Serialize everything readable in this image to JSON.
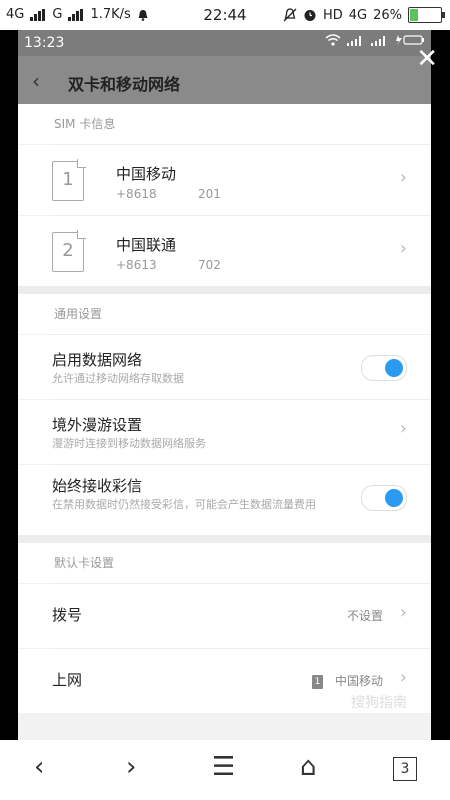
{
  "outer_status": {
    "carrier1": "4G",
    "carrier2": "G",
    "speed": "1.7K/s",
    "time": "22:44",
    "hd": "HD",
    "net": "4G",
    "battery": "26%"
  },
  "inner_status": {
    "time": "13:23"
  },
  "titlebar": {
    "back_glyph": "‹",
    "title": "双卡和移动网络"
  },
  "sim_section": {
    "header": "SIM 卡信息",
    "sims": [
      {
        "slot": "1",
        "name": "中国移动",
        "number_prefix": "+8618",
        "number_suffix": "201"
      },
      {
        "slot": "2",
        "name": "中国联通",
        "number_prefix": "+8613",
        "number_suffix": "702"
      }
    ]
  },
  "general_section": {
    "header": "通用设置",
    "data_network": {
      "title": "启用数据网络",
      "desc": "允许通过移动网络存取数据",
      "enabled": true
    },
    "roaming": {
      "title": "境外漫游设置",
      "desc": "漫游时连接到移动数据网络服务"
    },
    "mms": {
      "title": "始终接收彩信",
      "desc": "在禁用数据时仍然接受彩信，可能会产生数据流量费用",
      "enabled": true
    }
  },
  "default_section": {
    "header": "默认卡设置",
    "dial": {
      "title": "拨号",
      "value": "不设置"
    },
    "internet": {
      "title": "上网",
      "sim_badge": "1",
      "value": "中国移动"
    }
  },
  "overlay": {
    "close_glyph": "✕",
    "watermark": "搜狗指南"
  },
  "browser_nav": {
    "back": "‹",
    "forward": "›",
    "menu": "☰",
    "home": "⌂",
    "tabs_count": "3"
  },
  "colors": {
    "toggle_on": "#2b9af3",
    "battery_fill": "#5cc25a"
  }
}
